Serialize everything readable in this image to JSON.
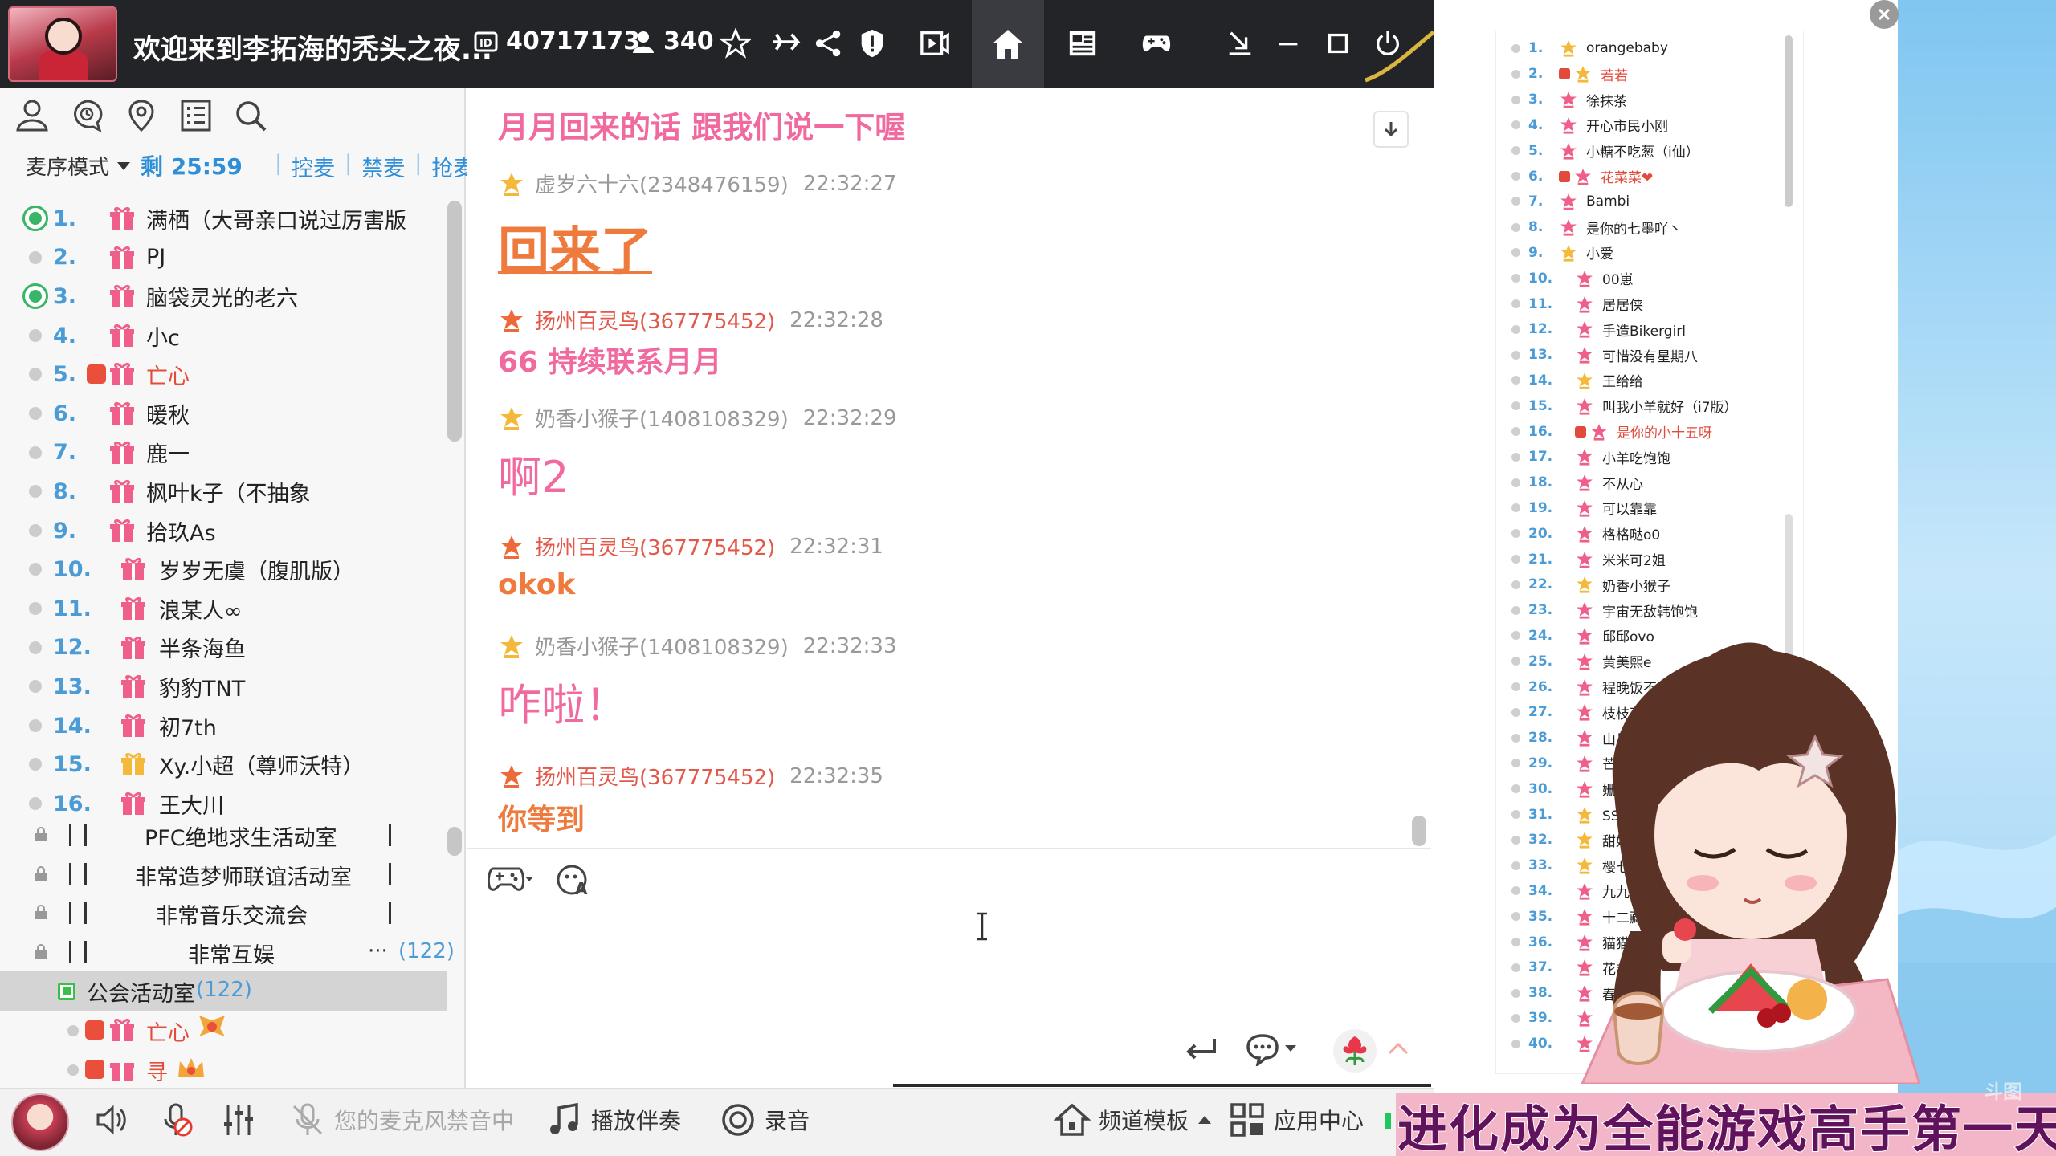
{
  "titlebar": {
    "room_title": "欢迎来到李拓海的秃头之夜...",
    "room_id": "40717173",
    "online_count": "340"
  },
  "left": {
    "mic_mode": "麦序模式",
    "timer": "剩 25:59",
    "actions": [
      "控麦",
      "禁麦",
      "抢麦"
    ],
    "queue": [
      {
        "num": "1.",
        "name": "满栖（大哥亲口说过厉害版",
        "active": true,
        "badge": false,
        "red": false,
        "gift": "pink"
      },
      {
        "num": "2.",
        "name": "PJ",
        "active": false,
        "badge": false,
        "red": false,
        "gift": "pink"
      },
      {
        "num": "3.",
        "name": "脑袋灵光的老六",
        "active": true,
        "badge": false,
        "red": false,
        "gift": "pink"
      },
      {
        "num": "4.",
        "name": "小c",
        "active": false,
        "badge": false,
        "red": false,
        "gift": "pink"
      },
      {
        "num": "5.",
        "name": "亡心",
        "active": false,
        "badge": true,
        "red": true,
        "gift": "pink"
      },
      {
        "num": "6.",
        "name": "暖秋",
        "active": false,
        "badge": false,
        "red": false,
        "gift": "pink"
      },
      {
        "num": "7.",
        "name": "鹿一",
        "active": false,
        "badge": false,
        "red": false,
        "gift": "pink"
      },
      {
        "num": "8.",
        "name": "枫叶k子（不抽象",
        "active": false,
        "badge": false,
        "red": false,
        "gift": "pink"
      },
      {
        "num": "9.",
        "name": "拾玖As",
        "active": false,
        "badge": false,
        "red": false,
        "gift": "pink"
      },
      {
        "num": "10.",
        "name": "岁岁无虞（腹肌版）",
        "active": false,
        "badge": false,
        "red": false,
        "gift": "pink"
      },
      {
        "num": "11.",
        "name": "浪某人∞",
        "active": false,
        "badge": false,
        "red": false,
        "gift": "pink"
      },
      {
        "num": "12.",
        "name": "半条海鱼",
        "active": false,
        "badge": false,
        "red": false,
        "gift": "pink"
      },
      {
        "num": "13.",
        "name": "豹豹TNT",
        "active": false,
        "badge": false,
        "red": false,
        "gift": "pink"
      },
      {
        "num": "14.",
        "name": "初7th",
        "active": false,
        "badge": false,
        "red": false,
        "gift": "pink"
      },
      {
        "num": "15.",
        "name": "Xy.小超（尊师沃特）",
        "active": false,
        "badge": false,
        "red": false,
        "gift": "gold"
      },
      {
        "num": "16.",
        "name": "王大川",
        "active": false,
        "badge": false,
        "red": false,
        "gift": "pink"
      }
    ],
    "channels": [
      {
        "name": "PFC绝地求生活动室"
      },
      {
        "name": "非常造梦师联谊活动室"
      },
      {
        "name": "非常音乐交流会"
      },
      {
        "name": "非常互娱",
        "more": "···",
        "count": "(122)"
      }
    ],
    "selected_channel": {
      "name": "公会活动室",
      "count": "(122)"
    },
    "sub_users": [
      {
        "name": "亡心"
      },
      {
        "name": "寻"
      }
    ]
  },
  "chat": {
    "partial_top": "月月回来的话 跟我们说一下喔",
    "messages": [
      {
        "nick": "虚岁六十六(2348476159)",
        "time": "22:32:27",
        "text": "回来了",
        "style": "big-orange",
        "nick_red": false,
        "crown": "gold"
      },
      {
        "nick": "扬州百灵鸟(367775452)",
        "time": "22:32:28",
        "text": "66 持续联系月月",
        "style": "pink",
        "nick_red": true,
        "crown": "orange"
      },
      {
        "nick": "奶香小猴子(1408108329)",
        "time": "22:32:29",
        "text": "啊2",
        "style": "pink-big",
        "nick_red": false,
        "crown": "gold"
      },
      {
        "nick": "扬州百灵鸟(367775452)",
        "time": "22:32:31",
        "text": "okok",
        "style": "orange",
        "nick_red": true,
        "crown": "orange"
      },
      {
        "nick": "奶香小猴子(1408108329)",
        "time": "22:32:33",
        "text": "咋啦！",
        "style": "pink-big",
        "nick_red": false,
        "crown": "gold"
      },
      {
        "nick": "扬州百灵鸟(367775452)",
        "time": "22:32:35",
        "text": "你等到",
        "style": "orange",
        "nick_red": true,
        "crown": "orange"
      }
    ]
  },
  "bottom": {
    "mic_muted_label": "您的麦克风禁音中",
    "play_music": "播放伴奏",
    "record": "录音",
    "channel_template": "频道模板",
    "app_center": "应用中心"
  },
  "userlist": [
    {
      "num": "1.",
      "name": "orangebaby",
      "red": false,
      "v": false,
      "crown": "gold"
    },
    {
      "num": "2.",
      "name": "若若",
      "red": true,
      "v": true,
      "crown": "gold"
    },
    {
      "num": "3.",
      "name": "徐抹茶",
      "red": false,
      "v": false,
      "crown": "pink"
    },
    {
      "num": "4.",
      "name": "开心市民小刚",
      "red": false,
      "v": false,
      "crown": "pink"
    },
    {
      "num": "5.",
      "name": "小糖不吃葱（i仙）",
      "red": false,
      "v": false,
      "crown": "pink"
    },
    {
      "num": "6.",
      "name": "花菜菜❤",
      "red": true,
      "v": true,
      "crown": "pink"
    },
    {
      "num": "7.",
      "name": "Bambi",
      "red": false,
      "v": false,
      "crown": "pink"
    },
    {
      "num": "8.",
      "name": "是你的七墨吖丶",
      "red": false,
      "v": false,
      "crown": "pink"
    },
    {
      "num": "9.",
      "name": "小爱",
      "red": false,
      "v": false,
      "crown": "gold"
    },
    {
      "num": "10.",
      "name": "00崽",
      "red": false,
      "v": false,
      "crown": "pink"
    },
    {
      "num": "11.",
      "name": "居居侠",
      "red": false,
      "v": false,
      "crown": "pink"
    },
    {
      "num": "12.",
      "name": "手造Bikergirl",
      "red": false,
      "v": false,
      "crown": "pink"
    },
    {
      "num": "13.",
      "name": "可惜没有星期八",
      "red": false,
      "v": false,
      "crown": "pink"
    },
    {
      "num": "14.",
      "name": "王给给",
      "red": false,
      "v": false,
      "crown": "gold"
    },
    {
      "num": "15.",
      "name": "叫我小羊就好（i7版）",
      "red": false,
      "v": false,
      "crown": "pink"
    },
    {
      "num": "16.",
      "name": "是你的小十五呀",
      "red": true,
      "v": true,
      "crown": "pink"
    },
    {
      "num": "17.",
      "name": "小羊吃饱饱",
      "red": false,
      "v": false,
      "crown": "pink"
    },
    {
      "num": "18.",
      "name": "不从心",
      "red": false,
      "v": false,
      "crown": "pink"
    },
    {
      "num": "19.",
      "name": "可以靠靠",
      "red": false,
      "v": false,
      "crown": "pink"
    },
    {
      "num": "20.",
      "name": "格格哒o0",
      "red": false,
      "v": false,
      "crown": "pink"
    },
    {
      "num": "21.",
      "name": "米米可2姐",
      "red": false,
      "v": false,
      "crown": "pink"
    },
    {
      "num": "22.",
      "name": "奶香小猴子",
      "red": false,
      "v": false,
      "crown": "gold"
    },
    {
      "num": "23.",
      "name": "宇宙无敌韩饱饱",
      "red": false,
      "v": false,
      "crown": "pink"
    },
    {
      "num": "24.",
      "name": "邱邱ovo",
      "red": false,
      "v": false,
      "crown": "pink"
    },
    {
      "num": "25.",
      "name": "黄美熙e",
      "red": false,
      "v": false,
      "crown": "pink"
    },
    {
      "num": "26.",
      "name": "程晚饭不是小海哥",
      "red": false,
      "v": false,
      "crown": "pink"
    },
    {
      "num": "27.",
      "name": "枝枝不知ˋ◇ˊ",
      "red": false,
      "v": false,
      "crown": "pink"
    },
    {
      "num": "28.",
      "name": "山丹丹",
      "red": false,
      "v": false,
      "crown": "pink"
    },
    {
      "num": "29.",
      "name": "芒芒iuk",
      "red": false,
      "v": false,
      "crown": "pink"
    },
    {
      "num": "30.",
      "name": "姗姗（隔",
      "red": false,
      "v": false,
      "crown": "pink"
    },
    {
      "num": "31.",
      "name": "SSR 小糊",
      "red": false,
      "v": false,
      "crown": "gold"
    },
    {
      "num": "32.",
      "name": "甜妹儿",
      "red": false,
      "v": false,
      "crown": "gold"
    },
    {
      "num": "33.",
      "name": "樱七七",
      "red": false,
      "v": false,
      "crown": "gold"
    },
    {
      "num": "34.",
      "name": "九九八十",
      "red": false,
      "v": false,
      "crown": "pink"
    },
    {
      "num": "35.",
      "name": "十二藏鸣",
      "red": false,
      "v": false,
      "crown": "pink"
    },
    {
      "num": "36.",
      "name": "猫猫Meo",
      "red": false,
      "v": false,
      "crown": "pink"
    },
    {
      "num": "37.",
      "name": "花卷卷",
      "red": false,
      "v": false,
      "crown": "pink"
    },
    {
      "num": "38.",
      "name": "春",
      "red": false,
      "v": false,
      "crown": "pink"
    },
    {
      "num": "39.",
      "name": "",
      "red": false,
      "v": false,
      "crown": "pink"
    },
    {
      "num": "40.",
      "name": "",
      "red": false,
      "v": false,
      "crown": "pink"
    }
  ],
  "banner": {
    "text": "进化成为全能游戏高手第一天"
  },
  "watermark": "斗图",
  "colors": {
    "accent_blue": "#4a9bd6",
    "chat_pink": "#f06aa0",
    "chat_orange": "#ee7b3d",
    "nick_red": "#e2584a",
    "titlebar": "#232427"
  }
}
